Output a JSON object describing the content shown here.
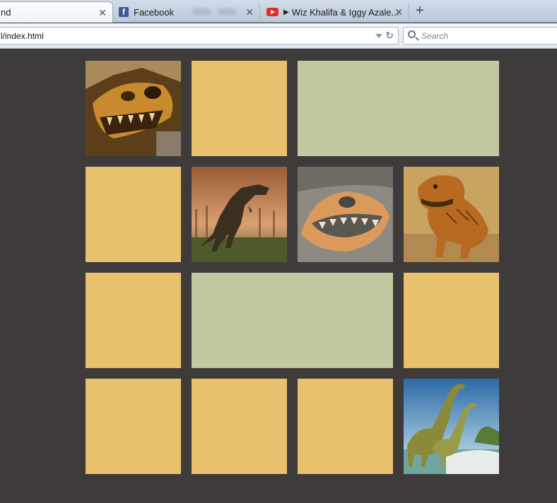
{
  "browser": {
    "tabs": [
      {
        "label": "nd",
        "icon": "page-icon",
        "active": true
      },
      {
        "label": "Facebook",
        "icon": "facebook-icon",
        "active": false
      },
      {
        "label": "Wiz Khalifa & Iggy Azale...",
        "icon": "youtube-icon",
        "active": false,
        "playing": true
      }
    ],
    "url": "l/index.html",
    "search_placeholder": "Search"
  },
  "colors": {
    "tile_yellow": "#e9c06b",
    "tile_green": "#c2c9a0",
    "background": "#3e3b3a"
  },
  "tiles": [
    {
      "kind": "photo",
      "subject": "dinosaur-skull-fossil"
    },
    {
      "kind": "yellow"
    },
    {
      "kind": "green",
      "span": 2
    },
    {
      "kind": "yellow"
    },
    {
      "kind": "photo",
      "subject": "t-rex-forest"
    },
    {
      "kind": "photo",
      "subject": "fossil-skull-rock"
    },
    {
      "kind": "photo",
      "subject": "t-rex-orange"
    },
    {
      "kind": "yellow"
    },
    {
      "kind": "green",
      "span": 2
    },
    {
      "kind": "yellow"
    },
    {
      "kind": "yellow"
    },
    {
      "kind": "yellow"
    },
    {
      "kind": "yellow"
    },
    {
      "kind": "photo",
      "subject": "sauropods-water"
    }
  ]
}
